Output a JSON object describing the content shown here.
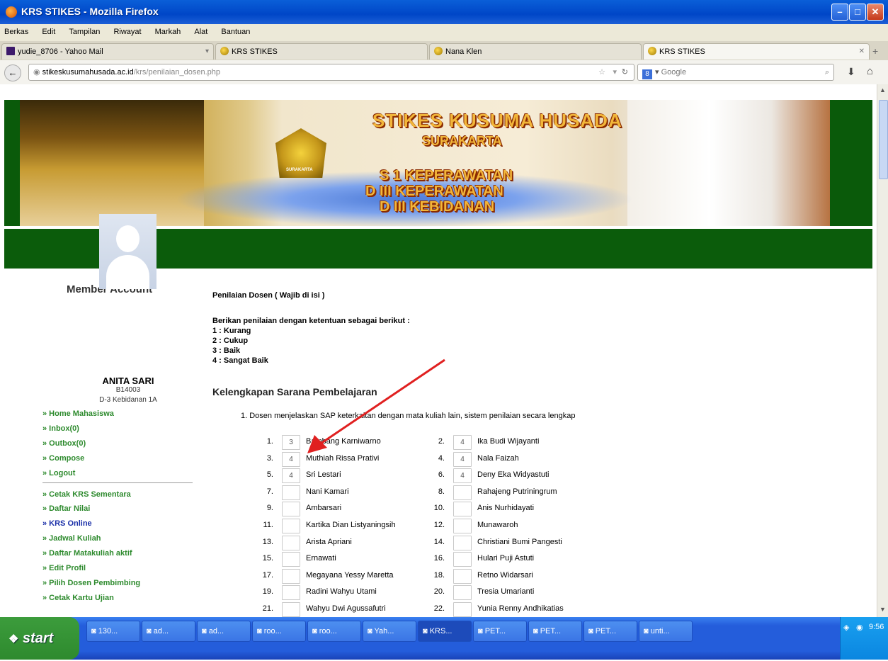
{
  "window": {
    "title": "KRS STIKES - Mozilla Firefox",
    "minimize": "–",
    "maximize": "□",
    "close": "✕"
  },
  "menubar": [
    "Berkas",
    "Edit",
    "Tampilan",
    "Riwayat",
    "Markah",
    "Alat",
    "Bantuan"
  ],
  "tabs": [
    {
      "label": "yudie_8706 - Yahoo Mail"
    },
    {
      "label": "KRS STIKES"
    },
    {
      "label": "Nana Klen"
    },
    {
      "label": "KRS STIKES"
    }
  ],
  "navbar": {
    "url_domain": "stikeskusumahusada.ac.id",
    "url_path": "/krs/penilaian_dosen.php",
    "search_placeholder": "Google"
  },
  "banner": {
    "school_line1": "STIKES KUSUMA HUSADA",
    "school_line2": "SURAKARTA",
    "crest_label": "SURAKARTA",
    "program1": "S 1 KEPERAWATAN",
    "program2": "D III KEPERAWATAN",
    "program3": "D III KEBIDANAN"
  },
  "sidebar": {
    "title": "Member Account",
    "name": "ANITA SARI",
    "nim": "B14003",
    "class": "D-3 Kebidanan 1A",
    "links_top": [
      "» Home Mahasiswa",
      "» Inbox(0)",
      "» Outbox(0)",
      "» Compose",
      "» Logout"
    ],
    "links_bottom": [
      "» Cetak KRS Sementara",
      "» Daftar Nilai",
      "» KRS Online",
      "» Jadwal Kuliah",
      "» Daftar Matakuliah aktif",
      "» Edit Profil",
      "» Pilih Dosen Pembimbing",
      "» Cetak Kartu Ujian"
    ]
  },
  "content": {
    "heading": "Penilaian Dosen ( Wajib di isi )",
    "instruction": "Berikan penilaian dengan ketentuan sebagai berikut :",
    "scale": [
      "1 : Kurang",
      "2 : Cukup",
      "3 : Baik",
      "4 : Sangat Baik"
    ],
    "section": "Kelengkapan Sarana Pembelajaran",
    "question": "1.  Dosen menjelaskan SAP keterkaitan dengan mata kuliah lain, sistem penilaian secara lengkap",
    "lecturers": [
      {
        "no": "1.",
        "value": "3",
        "name": "Bambang Karniwarno"
      },
      {
        "no": "2.",
        "value": "4",
        "name": "Ika Budi Wijayanti"
      },
      {
        "no": "3.",
        "value": "4",
        "name": "Muthiah Rissa Prativi"
      },
      {
        "no": "4.",
        "value": "4",
        "name": "Nala Faizah"
      },
      {
        "no": "5.",
        "value": "4",
        "name": "Sri Lestari"
      },
      {
        "no": "6.",
        "value": "4",
        "name": "Deny Eka Widyastuti"
      },
      {
        "no": "7.",
        "value": "",
        "name": "Nani Kamari"
      },
      {
        "no": "8.",
        "value": "",
        "name": "Rahajeng Putriningrum"
      },
      {
        "no": "9.",
        "value": "",
        "name": "Ambarsari"
      },
      {
        "no": "10.",
        "value": "",
        "name": "Anis Nurhidayati"
      },
      {
        "no": "11.",
        "value": "",
        "name": "Kartika Dian Listyaningsih"
      },
      {
        "no": "12.",
        "value": "",
        "name": "Munawaroh"
      },
      {
        "no": "13.",
        "value": "",
        "name": "Arista Apriani"
      },
      {
        "no": "14.",
        "value": "",
        "name": "Christiani Bumi Pangesti"
      },
      {
        "no": "15.",
        "value": "",
        "name": "Ernawati"
      },
      {
        "no": "16.",
        "value": "",
        "name": "Hulari Puji Astuti"
      },
      {
        "no": "17.",
        "value": "",
        "name": "Megayana Yessy Maretta"
      },
      {
        "no": "18.",
        "value": "",
        "name": "Retno Widarsari"
      },
      {
        "no": "19.",
        "value": "",
        "name": "Radini Wahyu Utami"
      },
      {
        "no": "20.",
        "value": "",
        "name": "Tresia Umarianti"
      },
      {
        "no": "21.",
        "value": "",
        "name": "Wahyu Dwi Agussafutri"
      },
      {
        "no": "22.",
        "value": "",
        "name": "Yunia Renny Andhikatias"
      }
    ]
  },
  "taskbar": {
    "start": "start",
    "buttons": [
      "130...",
      "ad...",
      "ad...",
      "roo...",
      "roo...",
      "Yah...",
      "KRS...",
      "PET...",
      "PET...",
      "PET...",
      "unti..."
    ],
    "clock": "9:56"
  },
  "colors": {
    "title_bar": "#0046c7",
    "banner_green": "#0b5c0b",
    "sidebar_link": "#2d8a2d",
    "sidebar_link_active": "#1a2fa8",
    "annotation_arrow": "#e02020"
  }
}
